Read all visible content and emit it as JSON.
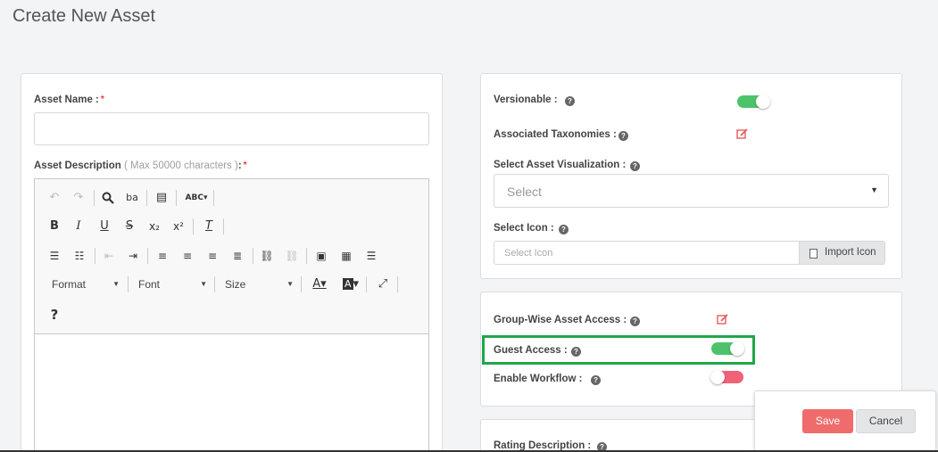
{
  "page": {
    "title": "Create New Asset"
  },
  "left": {
    "asset_name_label": "Asset Name :",
    "required_mark": "*",
    "asset_desc_label": "Asset Description",
    "asset_desc_hint": "( Max 50000 characters )",
    "asset_desc_colon": ":",
    "asset_name_value": "",
    "editor": {
      "format_label": "Format",
      "font_label": "Font",
      "size_label": "Size",
      "help_glyph": "?"
    }
  },
  "right": {
    "versionable_label": "Versionable :",
    "versionable_on": true,
    "taxonomies_label": "Associated Taxonomies :",
    "visualization_label": "Select Asset Visualization :",
    "visualization_value": "Select",
    "icon_label": "Select Icon :",
    "icon_placeholder": "Select Icon",
    "import_icon_label": "Import Icon",
    "group_access_label": "Group-Wise Asset Access :",
    "guest_access_label": "Guest Access :",
    "guest_access_on": true,
    "workflow_label": "Enable Workflow :",
    "workflow_on": false,
    "rating_desc_label": "Rating Description :"
  },
  "actions": {
    "save_label": "Save",
    "cancel_label": "Cancel"
  },
  "colors": {
    "toggle_on": "#4cc36b",
    "toggle_off": "#f06277",
    "save_button": "#f06b6b",
    "highlight": "#1fa74a",
    "edit_icon": "#e65c5c"
  }
}
